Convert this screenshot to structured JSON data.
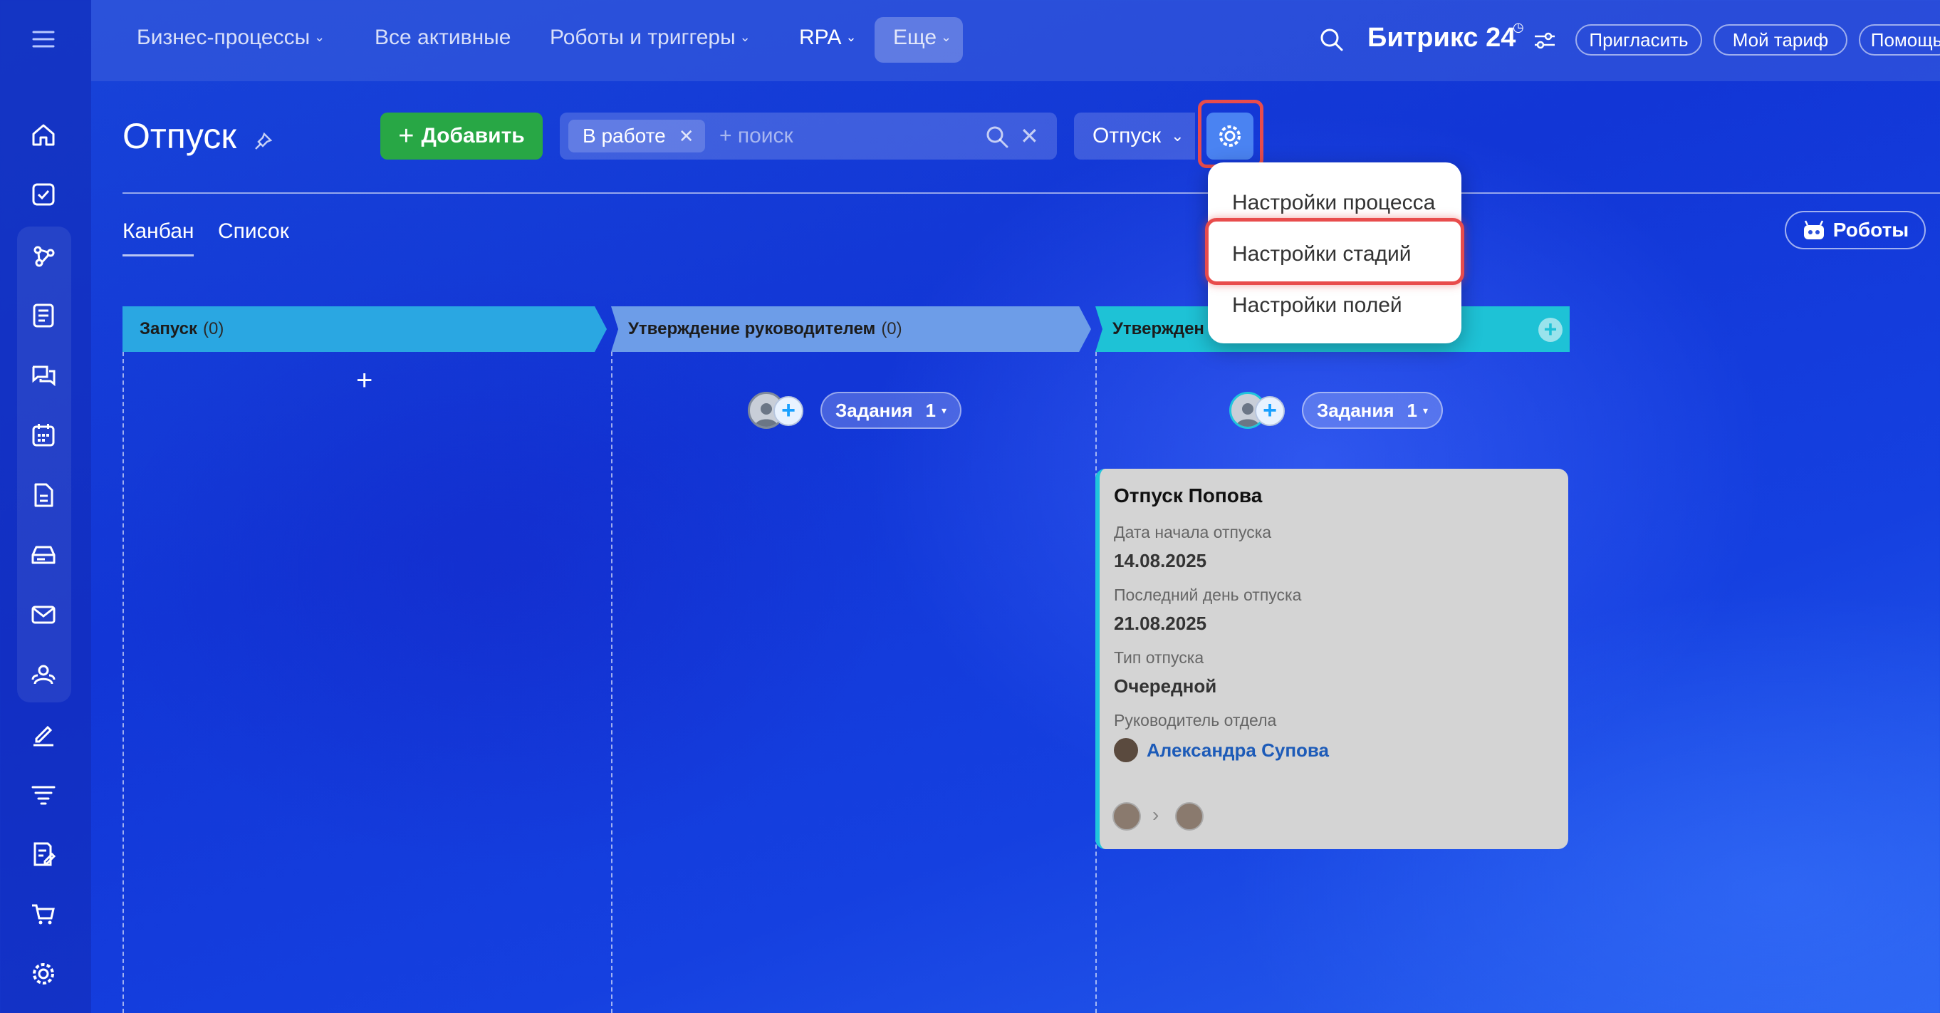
{
  "nav": {
    "items": [
      {
        "label": "Бизнес-процессы",
        "has_menu": true
      },
      {
        "label": "Все активные",
        "has_menu": false
      },
      {
        "label": "Роботы и триггеры",
        "has_menu": true
      },
      {
        "label": "RPA",
        "has_menu": true,
        "active": true
      },
      {
        "label": "Еще",
        "has_menu": true
      }
    ],
    "brand": "Битрикс 24",
    "invite": "Пригласить",
    "tariff": "Мой тариф",
    "help": "Помощь"
  },
  "header": {
    "title": "Отпуск",
    "add_button": "Добавить",
    "filter_tag": "В работе",
    "search_placeholder": "+ поиск",
    "process_select": "Отпуск"
  },
  "settings_menu": {
    "items": [
      "Настройки процесса",
      "Настройки стадий",
      "Настройки полей"
    ],
    "highlighted_index": 1
  },
  "views": {
    "tabs": [
      "Канбан",
      "Список"
    ],
    "active": "Канбан",
    "robots_button": "Роботы"
  },
  "stages": [
    {
      "name": "Запуск",
      "count": "(0)",
      "color": "#2aa7e2"
    },
    {
      "name": "Утверждение руководителем",
      "count": "(0)",
      "color": "#6d9de8"
    },
    {
      "name": "Утвержден",
      "count": "",
      "color": "#1ec2d6"
    }
  ],
  "tasks": [
    {
      "label": "Задания",
      "count": "1"
    },
    {
      "label": "Задания",
      "count": "1"
    }
  ],
  "card": {
    "title": "Отпуск Попова",
    "fields": [
      {
        "label": "Дата начала отпуска",
        "value": "14.08.2025"
      },
      {
        "label": "Последний день отпуска",
        "value": "21.08.2025"
      },
      {
        "label": "Тип отпуска",
        "value": "Очередной"
      }
    ],
    "manager_label": "Руководитель отдела",
    "manager_name": "Александра Супова"
  },
  "colors": {
    "add_button": "#28a745",
    "highlight": "#e84c4c",
    "gear_button": "#4a83f2"
  }
}
